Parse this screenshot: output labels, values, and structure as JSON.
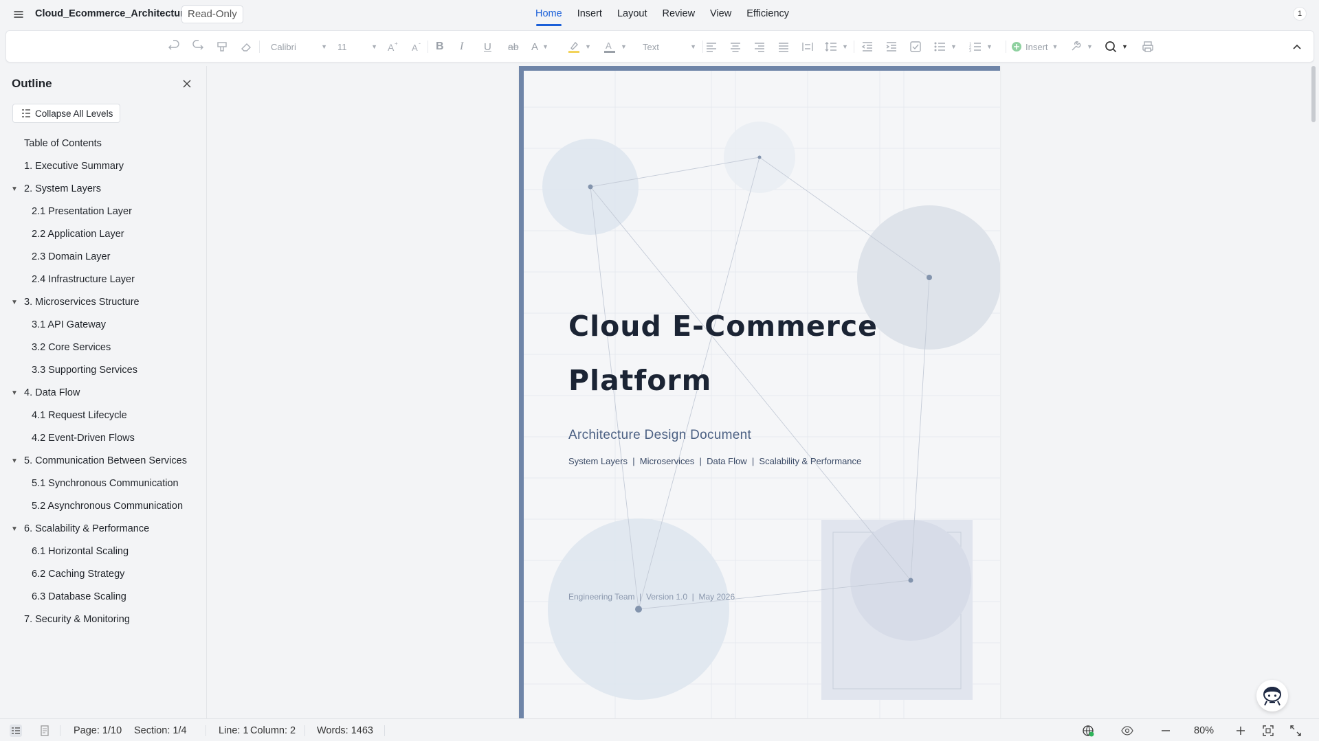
{
  "app": {
    "doc_title": "Cloud_Ecommerce_Architecture",
    "read_only_badge": "Read-Only",
    "notification_count": "1"
  },
  "main_tabs": [
    {
      "label": "Home",
      "active": true
    },
    {
      "label": "Insert",
      "active": false
    },
    {
      "label": "Layout",
      "active": false
    },
    {
      "label": "Review",
      "active": false
    },
    {
      "label": "View",
      "active": false
    },
    {
      "label": "Efficiency",
      "active": false
    }
  ],
  "toolbar": {
    "font_name": "Calibri",
    "font_size": "11",
    "style_name": "Text",
    "insert_label": "Insert",
    "icons": [
      "undo-icon",
      "redo-icon",
      "format-painter-icon",
      "eraser-icon",
      "increase-font-icon",
      "decrease-font-icon",
      "bold-icon",
      "italic-icon",
      "underline-icon",
      "strikethrough-icon",
      "text-effect-icon",
      "highlight-icon",
      "font-color-icon",
      "align-left-icon",
      "align-center-icon",
      "align-right-icon",
      "justify-icon",
      "distributed-icon",
      "line-spacing-icon",
      "decrease-indent-icon",
      "increase-indent-icon",
      "checkbox-icon",
      "bullet-list-icon",
      "numbered-list-icon",
      "insert-icon",
      "tools-icon",
      "search-icon",
      "print-icon",
      "collapse-ribbon-icon"
    ]
  },
  "outline": {
    "title": "Outline",
    "collapse_button": "Collapse All Levels",
    "items": [
      {
        "label": "Table of Contents",
        "level": 1,
        "expandable": false
      },
      {
        "label": "1. Executive Summary",
        "level": 1,
        "expandable": false
      },
      {
        "label": "2. System Layers",
        "level": 1,
        "expandable": true
      },
      {
        "label": "2.1 Presentation Layer",
        "level": 2,
        "expandable": false
      },
      {
        "label": "2.2 Application Layer",
        "level": 2,
        "expandable": false
      },
      {
        "label": "2.3 Domain Layer",
        "level": 2,
        "expandable": false
      },
      {
        "label": "2.4 Infrastructure Layer",
        "level": 2,
        "expandable": false
      },
      {
        "label": "3. Microservices Structure",
        "level": 1,
        "expandable": true
      },
      {
        "label": "3.1 API Gateway",
        "level": 2,
        "expandable": false
      },
      {
        "label": "3.2 Core Services",
        "level": 2,
        "expandable": false
      },
      {
        "label": "3.3 Supporting Services",
        "level": 2,
        "expandable": false
      },
      {
        "label": "4. Data Flow",
        "level": 1,
        "expandable": true
      },
      {
        "label": "4.1 Request Lifecycle",
        "level": 2,
        "expandable": false
      },
      {
        "label": "4.2 Event-Driven Flows",
        "level": 2,
        "expandable": false
      },
      {
        "label": "5. Communication Between Services",
        "level": 1,
        "expandable": true
      },
      {
        "label": "5.1 Synchronous Communication",
        "level": 2,
        "expandable": false
      },
      {
        "label": "5.2 Asynchronous Communication",
        "level": 2,
        "expandable": false
      },
      {
        "label": "6. Scalability & Performance",
        "level": 1,
        "expandable": true
      },
      {
        "label": "6.1 Horizontal Scaling",
        "level": 2,
        "expandable": false
      },
      {
        "label": "6.2 Caching Strategy",
        "level": 2,
        "expandable": false
      },
      {
        "label": "6.3 Database Scaling",
        "level": 2,
        "expandable": false
      },
      {
        "label": "7. Security & Monitoring",
        "level": 1,
        "expandable": false
      }
    ]
  },
  "document": {
    "title_line1": "Cloud E-Commerce",
    "title_line2": "Platform",
    "subtitle": "Architecture Design Document",
    "tags": "System Layers  |  Microservices  |  Data Flow  |  Scalability & Performance",
    "footer": "Engineering Team  |  Version 1.0  |  May 2026",
    "accent_color": "#6f85a8"
  },
  "statusbar": {
    "page": "Page: 1/10",
    "section": "Section: 1/4",
    "line": "Line: 1",
    "column": "Column: 2",
    "words": "Words: 1463",
    "zoom": "80%"
  }
}
